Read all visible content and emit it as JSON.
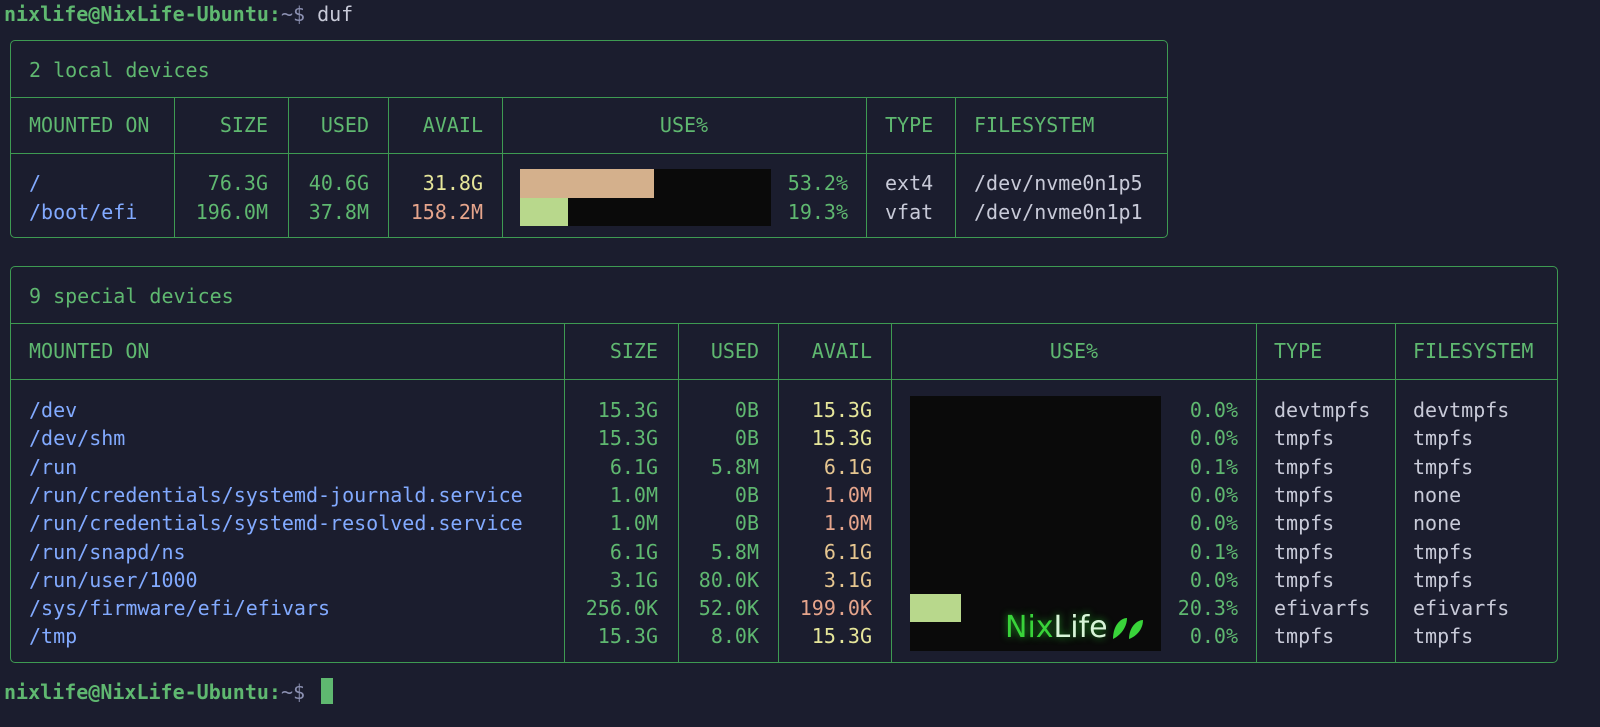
{
  "terminal": {
    "user_host": "nixlife@NixLife-Ubuntu",
    "colon": ":",
    "tilde": "~",
    "dollar": "$",
    "command": "duf"
  },
  "local": {
    "title": "2 local devices",
    "headers": [
      "MOUNTED ON",
      "SIZE",
      "USED",
      "AVAIL",
      "USE%",
      "TYPE",
      "FILESYSTEM"
    ],
    "rows": [
      {
        "mount": "/",
        "size": "76.3G",
        "used": "40.6G",
        "avail": "31.8G",
        "avail_state": "ok",
        "use_pct": "53.2%",
        "use_fraction": 0.532,
        "bar_color": "#d4b08c",
        "type": "ext4",
        "fs": "/dev/nvme0n1p5"
      },
      {
        "mount": "/boot/efi",
        "size": "196.0M",
        "used": "37.8M",
        "avail": "158.2M",
        "avail_state": "warn",
        "use_pct": "19.3%",
        "use_fraction": 0.193,
        "bar_color": "#b8d88c",
        "type": "vfat",
        "fs": "/dev/nvme0n1p1"
      }
    ]
  },
  "special": {
    "title": "9 special devices",
    "headers": [
      "MOUNTED ON",
      "SIZE",
      "USED",
      "AVAIL",
      "USE%",
      "TYPE",
      "FILESYSTEM"
    ],
    "rows": [
      {
        "mount": "/dev",
        "size": "15.3G",
        "used": "0B",
        "avail": "15.3G",
        "avail_state": "ok",
        "use_pct": "0.0%",
        "use_fraction": 0.0,
        "bar_color": "#b8d88c",
        "type": "devtmpfs",
        "fs": "devtmpfs"
      },
      {
        "mount": "/dev/shm",
        "size": "15.3G",
        "used": "0B",
        "avail": "15.3G",
        "avail_state": "ok",
        "use_pct": "0.0%",
        "use_fraction": 0.0,
        "bar_color": "#b8d88c",
        "type": "tmpfs",
        "fs": "tmpfs"
      },
      {
        "mount": "/run",
        "size": "6.1G",
        "used": "5.8M",
        "avail": "6.1G",
        "avail_state": "mid",
        "use_pct": "0.1%",
        "use_fraction": 0.001,
        "bar_color": "#b8d88c",
        "type": "tmpfs",
        "fs": "tmpfs"
      },
      {
        "mount": "/run/credentials/systemd-journald.service",
        "size": "1.0M",
        "used": "0B",
        "avail": "1.0M",
        "avail_state": "warn",
        "use_pct": "0.0%",
        "use_fraction": 0.0,
        "bar_color": "#b8d88c",
        "type": "tmpfs",
        "fs": "none"
      },
      {
        "mount": "/run/credentials/systemd-resolved.service",
        "size": "1.0M",
        "used": "0B",
        "avail": "1.0M",
        "avail_state": "warn",
        "use_pct": "0.0%",
        "use_fraction": 0.0,
        "bar_color": "#b8d88c",
        "type": "tmpfs",
        "fs": "none"
      },
      {
        "mount": "/run/snapd/ns",
        "size": "6.1G",
        "used": "5.8M",
        "avail": "6.1G",
        "avail_state": "mid",
        "use_pct": "0.1%",
        "use_fraction": 0.001,
        "bar_color": "#b8d88c",
        "type": "tmpfs",
        "fs": "tmpfs"
      },
      {
        "mount": "/run/user/1000",
        "size": "3.1G",
        "used": "80.0K",
        "avail": "3.1G",
        "avail_state": "mid",
        "use_pct": "0.0%",
        "use_fraction": 0.0,
        "bar_color": "#b8d88c",
        "type": "tmpfs",
        "fs": "tmpfs"
      },
      {
        "mount": "/sys/firmware/efi/efivars",
        "size": "256.0K",
        "used": "52.0K",
        "avail": "199.0K",
        "avail_state": "warn",
        "use_pct": "20.3%",
        "use_fraction": 0.203,
        "bar_color": "#b8d88c",
        "type": "efivarfs",
        "fs": "efivarfs"
      },
      {
        "mount": "/tmp",
        "size": "15.3G",
        "used": "8.0K",
        "avail": "15.3G",
        "avail_state": "ok",
        "use_pct": "0.0%",
        "use_fraction": 0.0,
        "bar_color": "#b8d88c",
        "type": "tmpfs",
        "fs": "tmpfs"
      }
    ]
  },
  "colors": {
    "background": "#1b1d2e",
    "border": "#3e9a52",
    "green": "#5fb870",
    "mount_blue": "#82aaff",
    "avail_ok": "#e6e69a",
    "avail_mid": "#e6c690",
    "avail_warn": "#e6a58c",
    "bar_track": "#0a0a0a"
  },
  "watermark": {
    "nix": "Nix",
    "life": "Life",
    "icon": "leaf-icon"
  }
}
